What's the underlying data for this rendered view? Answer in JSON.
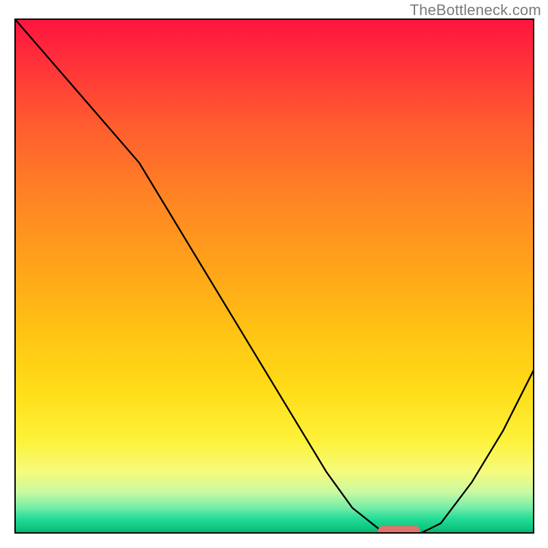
{
  "watermark": "TheBottleneck.com",
  "chart_data": {
    "type": "line",
    "title": "",
    "xlabel": "",
    "ylabel": "",
    "xlim": [
      0,
      100
    ],
    "ylim": [
      0,
      100
    ],
    "grid": false,
    "series": [
      {
        "name": "curve",
        "x": [
          0,
          6,
          12,
          18,
          24,
          30,
          36,
          42,
          48,
          54,
          60,
          65,
          70,
          74,
          78,
          82,
          88,
          94,
          100
        ],
        "values": [
          100,
          93,
          86,
          79,
          72,
          62,
          52,
          42,
          32,
          22,
          12,
          5,
          1,
          0,
          0,
          2,
          10,
          20,
          32
        ]
      }
    ],
    "marker": {
      "x_start": 70,
      "x_end": 78,
      "y": 0.6,
      "color": "#e1736f"
    },
    "background": "red-to-green vertical gradient"
  }
}
